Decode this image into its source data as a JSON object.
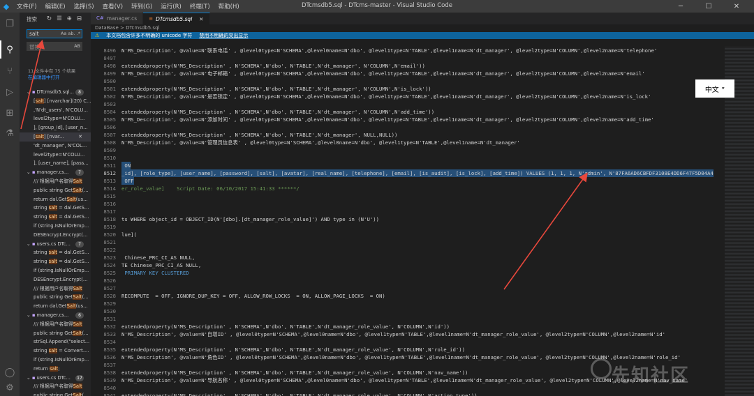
{
  "titlebar": {
    "menu": [
      "文件(F)",
      "编辑(E)",
      "选择(S)",
      "查看(V)",
      "转到(G)",
      "运行(R)",
      "终端(T)",
      "帮助(H)"
    ],
    "title": "DTcmsdb5.sql - DTcms-master - Visual Studio Code"
  },
  "sidebar": {
    "header": "搜索",
    "search_value": "salt",
    "search_opts": "Aa ab. .*",
    "replace_placeholder": "替换",
    "replace_opts": "AB",
    "summary": "11 文件中有 75 个结果",
    "open_in_editor": "在编辑器中打开",
    "tree": [
      {
        "type": "file",
        "name": "DTcmsdb5.sql...",
        "count": "8"
      },
      {
        "type": "match",
        "pre": "[",
        "hit": "salt",
        "post": "] [nvarchar](20) C..."
      },
      {
        "type": "match",
        "pre": "",
        "hit": "",
        "post": ",'N'dt_users', N'COLU..."
      },
      {
        "type": "match",
        "pre": "",
        "hit": "",
        "post": "level2type=N'COLU..."
      },
      {
        "type": "match",
        "pre": "",
        "hit": "",
        "post": "], [group_id], [user_n..."
      },
      {
        "type": "match",
        "pre": "[",
        "hit": "salt",
        "post": "] [nvar...",
        "selected": true
      },
      {
        "type": "match",
        "pre": "",
        "hit": "",
        "post": "'dt_manager', N'COL..."
      },
      {
        "type": "match",
        "pre": "",
        "hit": "",
        "post": "level2type=N'COLU..."
      },
      {
        "type": "match",
        "pre": "",
        "hit": "",
        "post": "], [user_name], [pass..."
      },
      {
        "type": "file",
        "name": "manager.cs...",
        "count": "7"
      },
      {
        "type": "match",
        "pre": "/// 根据用户名取得",
        "hit": "Salt",
        "post": ""
      },
      {
        "type": "match",
        "pre": "public string Get",
        "hit": "Salt",
        "post": "(..."
      },
      {
        "type": "match",
        "pre": "return dal.Get",
        "hit": "Salt",
        "post": "(us..."
      },
      {
        "type": "match",
        "pre": "string ",
        "hit": "salt",
        "post": " = dal.GetS..."
      },
      {
        "type": "match",
        "pre": "string ",
        "hit": "salt",
        "post": " = dal.GetS..."
      },
      {
        "type": "match",
        "pre": "if (string.IsNullOrEmp...",
        "hit": "",
        "post": ""
      },
      {
        "type": "match",
        "pre": "DESEncrypt.Encrypt(...",
        "hit": "",
        "post": ""
      },
      {
        "type": "file",
        "name": "users.cs DTc...",
        "count": "7"
      },
      {
        "type": "match",
        "pre": "string ",
        "hit": "salt",
        "post": " = dal.GetS..."
      },
      {
        "type": "match",
        "pre": "string ",
        "hit": "salt",
        "post": " = dal.GetS..."
      },
      {
        "type": "match",
        "pre": "if (string.IsNullOrEmp...",
        "hit": "",
        "post": ""
      },
      {
        "type": "match",
        "pre": "DESEncrypt.Encrypt(...",
        "hit": "",
        "post": ""
      },
      {
        "type": "match",
        "pre": "/// 根据用户名取得",
        "hit": "Salt",
        "post": ""
      },
      {
        "type": "match",
        "pre": "public string Get",
        "hit": "Salt",
        "post": "(..."
      },
      {
        "type": "match",
        "pre": "return dal.Get",
        "hit": "Salt",
        "post": "(us..."
      },
      {
        "type": "file",
        "name": "manager.cs...",
        "count": "6"
      },
      {
        "type": "match",
        "pre": "/// 根据用户名取得",
        "hit": "Salt",
        "post": ""
      },
      {
        "type": "match",
        "pre": "public string Get",
        "hit": "Salt",
        "post": "(..."
      },
      {
        "type": "match",
        "pre": "strSql.Append(\"select...",
        "hit": "",
        "post": ""
      },
      {
        "type": "match",
        "pre": "string ",
        "hit": "salt",
        "post": " = Convert...."
      },
      {
        "type": "match",
        "pre": "if (string.IsNullOrEmp...",
        "hit": "",
        "post": ""
      },
      {
        "type": "match",
        "pre": "return ",
        "hit": "salt",
        "post": ";"
      },
      {
        "type": "file",
        "name": "users.cs DTc...",
        "count": "17"
      },
      {
        "type": "match",
        "pre": "/// 根据用户名取得",
        "hit": "Salt",
        "post": ""
      },
      {
        "type": "match",
        "pre": "public string Get",
        "hit": "Salt",
        "post": "(..."
      },
      {
        "type": "match",
        "pre": "//尝试用户名取得",
        "hit": "Salt",
        "post": ""
      }
    ]
  },
  "editor": {
    "tabs": [
      {
        "label": "manager.cs",
        "active": false
      },
      {
        "label": "DTcmsdb5.sql",
        "active": true
      }
    ],
    "breadcrumb": "DataBase > DTcmsdb5.sql",
    "notice_text": "本文档包含许多不明确的 unicode 字符",
    "notice_action": "禁用不明确的突出显示",
    "lines": [
      {
        "n": "8496",
        "t": "N'MS_Description', @value=N'联系电话' , @level0type=N'SCHEMA',@level0name=N'dbo', @level1type=N'TABLE',@level1name=N'dt_manager', @level2type=N'COLUMN',@level2name=N'telephone'"
      },
      {
        "n": "8497",
        "t": ""
      },
      {
        "n": "8498",
        "t": "extendedproperty(N'MS_Description' , N'SCHEMA',N'dbo', N'TABLE',N'dt_manager', N'COLUMN',N'email'))"
      },
      {
        "n": "8499",
        "t": "N'MS_Description', @value=N'电子邮箱' , @level0type=N'SCHEMA',@level0name=N'dbo', @level1type=N'TABLE',@level1name=N'dt_manager', @level2type=N'COLUMN',@level2name=N'email'"
      },
      {
        "n": "8500",
        "t": ""
      },
      {
        "n": "8501",
        "t": "extendedproperty(N'MS_Description' , N'SCHEMA',N'dbo', N'TABLE',N'dt_manager', N'COLUMN',N'is_lock'))"
      },
      {
        "n": "8502",
        "t": "N'MS_Description', @value=N'是否锁定' , @level0type=N'SCHEMA',@level0name=N'dbo', @level1type=N'TABLE',@level1name=N'dt_manager', @level2type=N'COLUMN',@level2name=N'is_lock'"
      },
      {
        "n": "8503",
        "t": ""
      },
      {
        "n": "8504",
        "t": "extendedproperty(N'MS_Description' , N'SCHEMA',N'dbo', N'TABLE',N'dt_manager', N'COLUMN',N'add_time'))"
      },
      {
        "n": "8505",
        "t": "N'MS_Description', @value=N'添加时间' , @level0type=N'SCHEMA',@level0name=N'dbo', @level1type=N'TABLE',@level1name=N'dt_manager', @level2type=N'COLUMN',@level2name=N'add_time'"
      },
      {
        "n": "8506",
        "t": ""
      },
      {
        "n": "8507",
        "t": "extendedproperty(N'MS_Description' , N'SCHEMA',N'dbo', N'TABLE',N'dt_manager', NULL,NULL))"
      },
      {
        "n": "8508",
        "t": "N'MS_Description', @value=N'管理员信息表' , @level0type=N'SCHEMA',@level0name=N'dbo', @level1type=N'TABLE',@level1name=N'dt_manager'"
      },
      {
        "n": "8509",
        "t": ""
      },
      {
        "n": "8510",
        "t": ""
      },
      {
        "n": "8511",
        "t": " ON",
        "sel": true
      },
      {
        "n": "8512",
        "t": "_id], [role_type], [user_name], [password], [salt], [avatar], [real_name], [telephone], [email], [is_audit], [is_lock], [add_time]) VALUES (1, 1, 1, N'admin', N'87FA6AD6CBFDF3108E4DD6F47F5D04A4",
        "sel": true,
        "cur": true
      },
      {
        "n": "8513",
        "t": " OFF",
        "sel": true
      },
      {
        "n": "8514",
        "t": "er_role_value]    Script Date: 06/10/2017 15:41:33 ******/",
        "cm": true
      },
      {
        "n": "8515",
        "t": ""
      },
      {
        "n": "8516",
        "t": ""
      },
      {
        "n": "8517",
        "t": ""
      },
      {
        "n": "8518",
        "t": "ts WHERE object_id = OBJECT_ID(N'[dbo].[dt_manager_role_value]') AND type in (N'U'))"
      },
      {
        "n": "8519",
        "t": ""
      },
      {
        "n": "8520",
        "t": "lue]("
      },
      {
        "n": "8521",
        "t": ""
      },
      {
        "n": "8522",
        "t": ""
      },
      {
        "n": "8523",
        "t": " Chinese_PRC_CI_AS NULL,"
      },
      {
        "n": "8524",
        "t": "TE Chinese_PRC_CI_AS NULL,"
      },
      {
        "n": "8525",
        "t": " PRIMARY KEY CLUSTERED",
        "kw": true
      },
      {
        "n": "8526",
        "t": ""
      },
      {
        "n": "8527",
        "t": ""
      },
      {
        "n": "8528",
        "t": "RECOMPUTE  = OFF, IGNORE_DUP_KEY = OFF, ALLOW_ROW_LOCKS  = ON, ALLOW_PAGE_LOCKS  = ON)"
      },
      {
        "n": "8529",
        "t": ""
      },
      {
        "n": "8530",
        "t": ""
      },
      {
        "n": "8531",
        "t": ""
      },
      {
        "n": "8532",
        "t": "extendedproperty(N'MS_Description' , N'SCHEMA',N'dbo', N'TABLE',N'dt_manager_role_value', N'COLUMN',N'id'))"
      },
      {
        "n": "8533",
        "t": "N'MS_Description', @value=N'自增ID' , @level0type=N'SCHEMA',@level0name=N'dbo', @level1type=N'TABLE',@level1name=N'dt_manager_role_value', @level2type=N'COLUMN',@level2name=N'id'"
      },
      {
        "n": "8534",
        "t": ""
      },
      {
        "n": "8535",
        "t": "extendedproperty(N'MS_Description' , N'SCHEMA',N'dbo', N'TABLE',N'dt_manager_role_value', N'COLUMN',N'role_id'))"
      },
      {
        "n": "8536",
        "t": "N'MS_Description', @value=N'角色ID' , @level0type=N'SCHEMA',@level0name=N'dbo', @level1type=N'TABLE',@level1name=N'dt_manager_role_value', @level2type=N'COLUMN',@level2name=N'role_id'"
      },
      {
        "n": "8537",
        "t": ""
      },
      {
        "n": "8538",
        "t": "extendedproperty(N'MS_Description' , N'SCHEMA',N'dbo', N'TABLE',N'dt_manager_role_value', N'COLUMN',N'nav_name'))"
      },
      {
        "n": "8539",
        "t": "N'MS_Description', @value=N'导航名称' , @level0type=N'SCHEMA',@level0name=N'dbo', @level1type=N'TABLE',@level1name=N'dt_manager_role_value', @level2type=N'COLUMN',@level2name=N'nav_name'"
      },
      {
        "n": "8540",
        "t": ""
      },
      {
        "n": "8541",
        "t": "extendedproperty(N'MS_Description' , N'SCHEMA',N'dbo', N'TABLE',N'dt_manager_role_value', N'COLUMN',N'action_type'))"
      }
    ]
  },
  "annotation": {
    "callout_text": "中文 ”",
    "arrow_color": "#e8483c"
  },
  "watermark": {
    "text": "先知社区"
  },
  "colors": {
    "accent": "#007acc",
    "activitybar": "#333333",
    "sidebar": "#252526",
    "editor": "#1e1e1e",
    "selection": "#264f78"
  }
}
